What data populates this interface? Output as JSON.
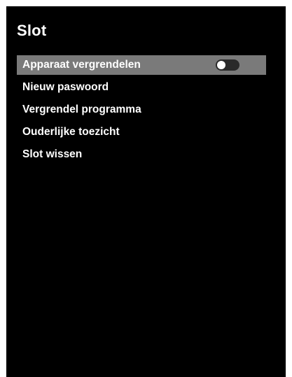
{
  "menu": {
    "title": "Slot",
    "items": [
      {
        "label": "Apparaat vergrendelen",
        "selected": true,
        "toggle": {
          "on": false
        }
      },
      {
        "label": "Nieuw paswoord",
        "selected": false
      },
      {
        "label": "Vergrendel programma",
        "selected": false
      },
      {
        "label": "Ouderlijke toezicht",
        "selected": false
      },
      {
        "label": "Slot wissen",
        "selected": false
      }
    ]
  },
  "colors": {
    "background": "#000000",
    "text": "#ffffff",
    "highlight": "#7a7a7a",
    "toggle_track_off": "#2a2a2a",
    "toggle_knob": "#ffffff"
  }
}
